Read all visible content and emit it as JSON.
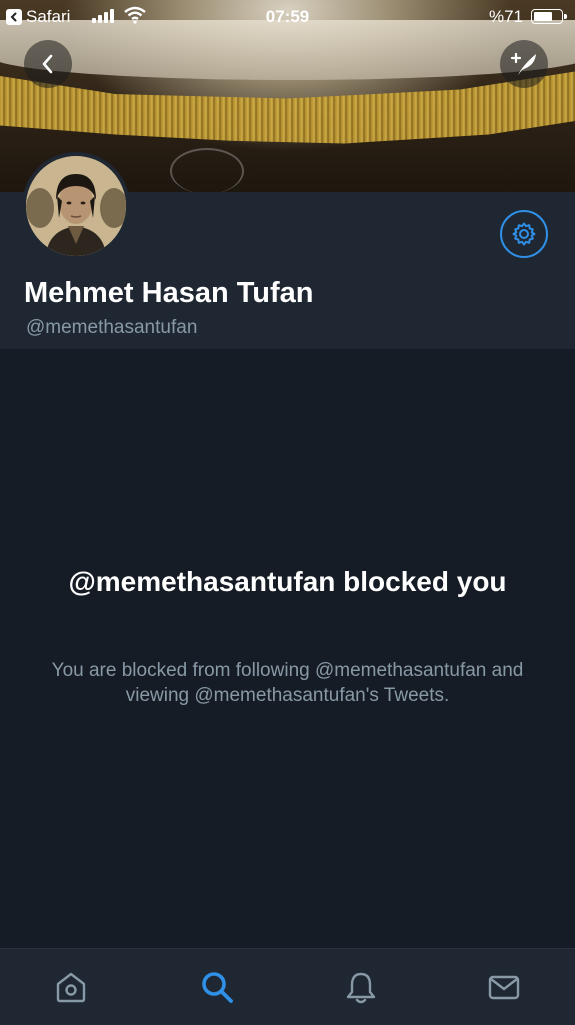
{
  "status_bar": {
    "back_app": "Safari",
    "time": "07:59",
    "battery_percent": "%71",
    "battery_level": 0.71
  },
  "profile": {
    "name": "Mehmet Hasan Tufan",
    "handle": "@memethasantufan"
  },
  "blocked": {
    "title": "@memethasantufan blocked you",
    "description": "You are blocked from following @memethasantufan and viewing @memethasantufan's Tweets."
  },
  "tab_bar": {
    "active": "search",
    "tabs": [
      "home-icon",
      "search-icon",
      "notifications-icon",
      "messages-icon"
    ]
  },
  "colors": {
    "accent": "#2f90e6",
    "background": "#161c25",
    "header": "#1f2733",
    "muted_text": "#8899a6"
  }
}
